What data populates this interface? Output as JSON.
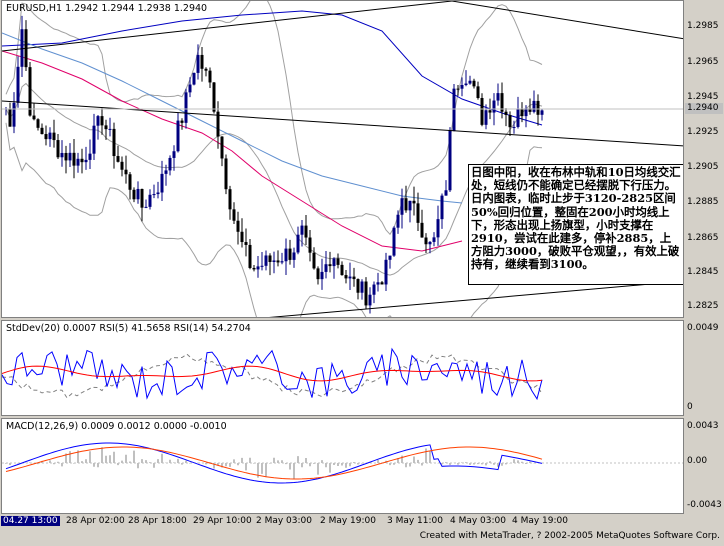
{
  "main": {
    "header": "EURUSD,H1  1.2942 1.2944 1.2938 1.2940",
    "price_axis": [
      "1.2985",
      "1.2965",
      "1.2945",
      "1.2925",
      "1.2905",
      "1.2885",
      "1.2865",
      "1.2845",
      "1.2825"
    ],
    "current_price": "1.2940",
    "annotation": "日图中阳，收在布林中轨和10日均线交汇处，短线仍不能确定已经摆脱下行压力。日内图表，临时止步于3120-2825区间50%回归位置，整固在200小时均线上下，形态出现上扬旗型，小时支撑在2910，尝试在此建多，停补2885，上方阻力3000，破败平仓观望，，有效上破持有，继续看到3100。"
  },
  "indicator1": {
    "header": "StdDev(20) 0.0007  RSI(5) 41.5658  RSI(14) 54.2704",
    "axis": [
      "0.0049",
      "0"
    ]
  },
  "indicator2": {
    "header": "MACD(12,26,9) 0.0009 0.0012 0.0000 -0.0010",
    "axis": [
      "0.0043",
      "0.00",
      "-0.0043"
    ]
  },
  "time_axis": [
    "04.27 13:00",
    "28 Apr 02:00",
    "28 Apr 18:00",
    "29 Apr 10:00",
    "2 May 03:00",
    "2 May 19:00",
    "3 May 11:00",
    "4 May 03:00",
    "4 May 19:00"
  ],
  "credit": "Created with MetaTrader, ? 2002-2005 MetaQuotes Software Corp.",
  "colors": {
    "up_candle": "#000080",
    "down_candle": "#000000",
    "bollinger": "#a0a0a0",
    "ma_blue": "#0000c0",
    "ma_light_blue": "#6090d0",
    "ma_magenta": "#e0006a",
    "trendline": "#000000",
    "rsi5": "#0000ff",
    "rsi14": "#ff0000",
    "stddev": "#808080",
    "macd_line": "#0000ff",
    "signal_line": "#ff4000",
    "histogram": "#808080"
  }
}
